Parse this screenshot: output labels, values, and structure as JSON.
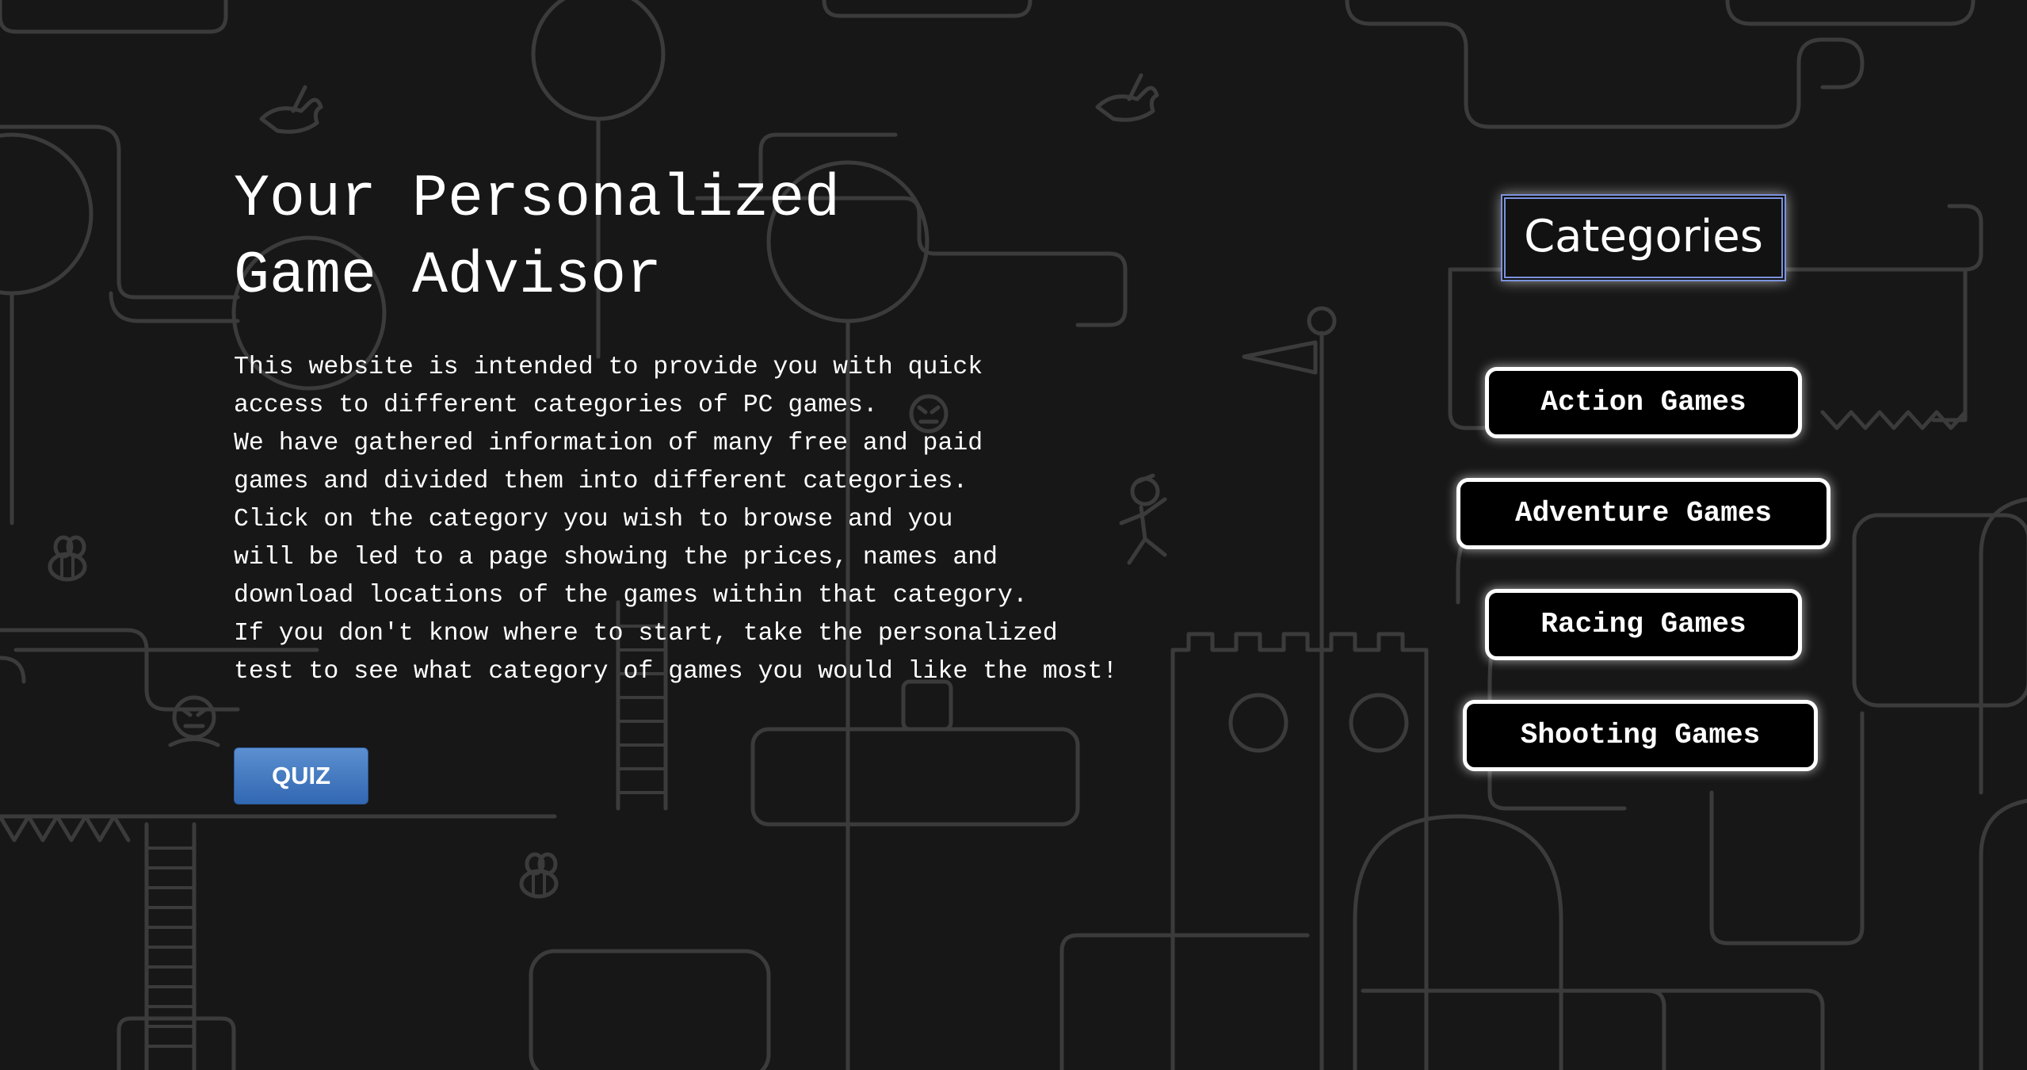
{
  "hero": {
    "title_lines": [
      "Your Personalized",
      "Game Advisor"
    ],
    "intro_lines": [
      "This website is intended to provide you with quick",
      "access to different categories of PC games.",
      "We have gathered information of many free and paid",
      "games and divided them into different categories.",
      "Click on the category you wish to browse and you",
      "will be led to a page showing the prices, names and",
      "download locations of the games within that category.",
      "If you don't know where to start, take the personalized",
      "test to see what category of games you would like the most!"
    ],
    "quiz_label": "QUIZ"
  },
  "categories": {
    "heading": "Categories",
    "items": [
      {
        "label": "Action Games"
      },
      {
        "label": "Adventure Games"
      },
      {
        "label": "Racing Games"
      },
      {
        "label": "Shooting Games"
      }
    ]
  },
  "theme": {
    "background": "#171717",
    "line_art": "#3b3b3b",
    "quiz_button": "#3f74bd",
    "heading_border": "#7c92dc",
    "text": "#ffffff"
  },
  "icons": [
    "bird-icon",
    "bee-icon",
    "flag-icon",
    "castle-icon",
    "character-icon",
    "angry-face-icon"
  ]
}
